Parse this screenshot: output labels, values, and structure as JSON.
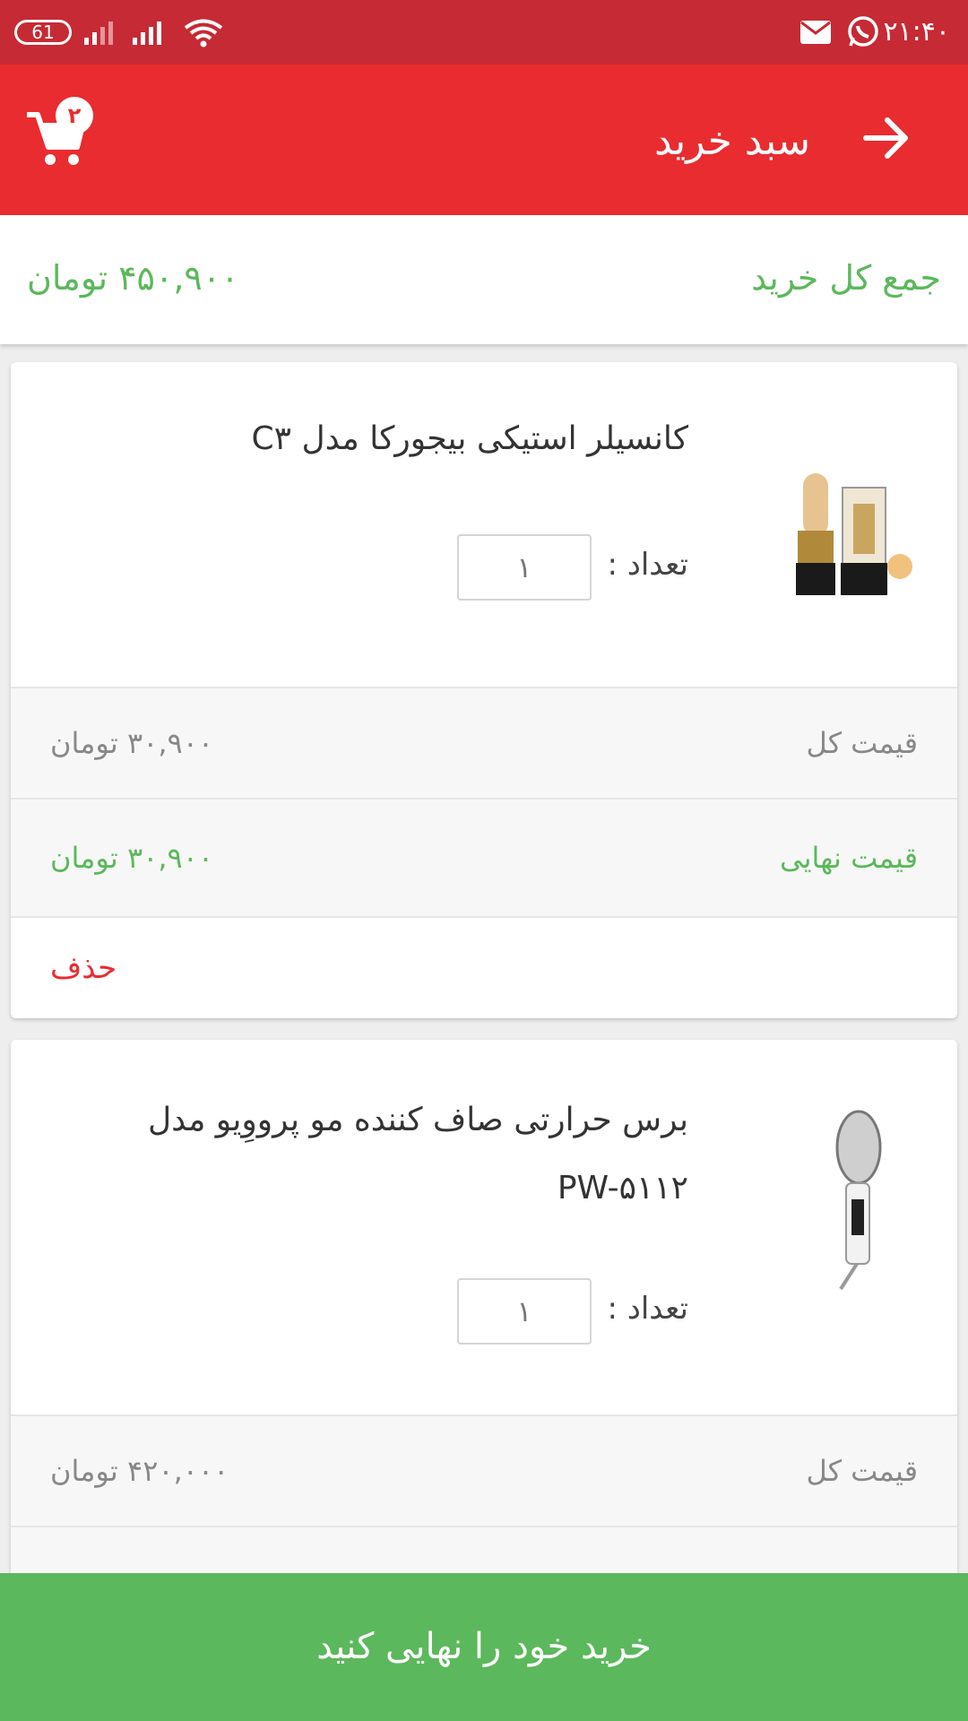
{
  "status_bar": {
    "time": "۲۱:۴۰",
    "battery": "61"
  },
  "app_bar": {
    "title": "سبد خرید",
    "cart_count": "۲"
  },
  "summary": {
    "label": "جمع کل خرید",
    "amount": "۴۵۰,۹۰۰  تومان"
  },
  "items": [
    {
      "name": "کانسیلر استیکی بیجورکا مدل C۳",
      "qty_label": "تعداد :",
      "qty_value": "۱",
      "total_label": "قیمت کل",
      "total_value": "۳۰,۹۰۰  تومان",
      "final_label": "قیمت نهایی",
      "final_value": "۳۰,۹۰۰  تومان",
      "delete_label": "حذف"
    },
    {
      "name": "برس حرارتی صاف کننده مو پرووِیو مدل PW-۵۱۱۲",
      "qty_label": "تعداد :",
      "qty_value": "۱",
      "total_label": "قیمت کل",
      "total_value": "۴۲۰,۰۰۰  تومان"
    }
  ],
  "checkout": {
    "label": "خرید خود را نهایی کنید"
  },
  "colors": {
    "status_bar": "#c62a35",
    "app_bar": "#e92c30",
    "green": "#5cb85c",
    "delete": "#e92c30"
  }
}
